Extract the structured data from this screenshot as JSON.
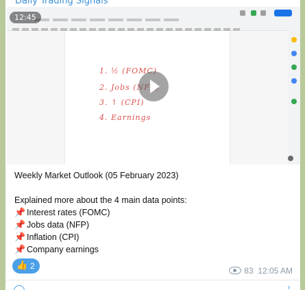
{
  "channel": {
    "title": "Daily Trading Signals"
  },
  "video": {
    "duration": "12:45",
    "notes": [
      "1. ½ (FOMC)",
      "2. Jobs (NFP)",
      "3. ↑ (CPI)",
      "4. Earnings"
    ],
    "play_icon": "play-icon",
    "settings_icon": "gear-icon"
  },
  "message": {
    "title": "Weekly Market Outlook (05 February 2023)",
    "intro": "Explained more about the 4 main data points:",
    "pin_glyph": "📌",
    "points": [
      "Interest rates (FOMC)",
      "Jobs data (NFP)",
      "Inflation (CPI)",
      "Company earnings"
    ]
  },
  "reaction": {
    "emoji": "👍",
    "count": "2"
  },
  "meta": {
    "views": "83",
    "time": "12:05 AM"
  },
  "colors": {
    "accent": "#4ca0e8",
    "link": "#3a8fd6",
    "handwriting": "#d9534f"
  }
}
